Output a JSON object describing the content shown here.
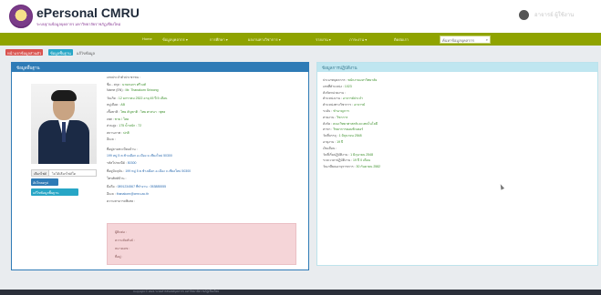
{
  "app": {
    "title": "ePersonal CMRU",
    "subtitle": "ระบบฐานข้อมูลบุคลากร มหาวิทยาลัยราชภัฏเชียงใหม่",
    "user_name": "อาจารย์ ผู้ใช้งาน"
  },
  "nav": {
    "items": [
      "Home",
      "ข้อมูลบุคลากร ▾",
      "การศึกษา ▾",
      "ผลงานทางวิชาการ ▾",
      "รายงาน ▾",
      "ภาระงาน ▾",
      "ติดต่อเรา"
    ],
    "search_placeholder": "ค้นหาข้อมูลบุคลากร"
  },
  "breadcrumbs": [
    "หน้าแรกข้อมูลส่วนตัว",
    "ข้อมูลพื้นฐาน",
    "แก้ไขข้อมูล"
  ],
  "colors": {
    "nav": "#8fa300",
    "panel_blue": "#2e7bb6",
    "panel_cyan": "#bfe6f0",
    "danger_box": "#f5d5d8"
  },
  "left_panel": {
    "title": "ข้อมูลพื้นฐาน",
    "file_button": "เลือกไฟล์",
    "file_text": "ไม่ได้เลือกไฟล์ใด",
    "upload_button": "อัปโหลดรูป",
    "edit_button": "แก้ไขข้อมูลพื้นฐาน",
    "lines": [
      [
        "เลขประจำตัวประชาชน :",
        ""
      ],
      [
        "ชื่อ - สกุล :",
        "นายธนกร  ศรีวงศ์"
      ],
      [
        "Name (EN) :",
        "Mr. Thanakorn  Sriwong"
      ],
      [
        "วันเกิด :",
        "12 มกราคม 2522  อายุ 45 ปี 5 เดือน"
      ],
      [
        "หมู่เลือด :",
        "AB"
      ],
      [
        "เชื้อชาติ :",
        "ไทย   สัญชาติ : ไทย   ศาสนา : พุทธ"
      ],
      [
        "เพศ :",
        "ชาย / โสด"
      ],
      [
        "ส่วนสูง :",
        "175  น้ำหนัก : 72"
      ],
      [
        "สถานภาพ :",
        "ปกติ"
      ],
      [
        "อีเมล :",
        ""
      ]
    ],
    "address_header": "ที่อยู่ตามทะเบียนบ้าน :",
    "address_lines": [
      [
        "",
        "199 หมู่ 5 ต.ช้างเผือก อ.เมือง จ.เชียงใหม่ 50300"
      ],
      [
        "รหัสไปรษณีย์ :",
        "50300"
      ],
      [
        "ที่อยู่ปัจจุบัน :",
        "199 หมู่ 5 ต.ช้างเผือก อ.เมือง จ.เชียงใหม่ 50300"
      ],
      [
        "โทรศัพท์บ้าน :",
        ""
      ],
      [
        "มือถือ :",
        "0891234567  ที่ทำงาน : 053885555"
      ],
      [
        "อีเมล :",
        "thanakorn@cmru.ac.th"
      ],
      [
        "ความสามารถพิเศษ :",
        ""
      ]
    ],
    "alert_lines": [
      "ผู้ติดต่อ :",
      "ความสัมพันธ์ :",
      "หมายเลข :",
      "ที่อยู่ :"
    ]
  },
  "right_panel": {
    "title": "ข้อมูลการปฏิบัติงาน",
    "lines": [
      [
        "ประเภทบุคลากร :",
        "พนักงานมหาวิทยาลัย"
      ],
      [
        "เลขที่ตำแหน่ง :",
        "1023"
      ],
      [
        "สังกัดหน่วยงาน :",
        ""
      ],
      [
        "ตำแหน่งงาน :",
        "อาจารย์ประจำ"
      ],
      [
        "ตำแหน่งทางวิชาการ :",
        "อาจารย์"
      ],
      [
        "ระดับ :",
        "ชำนาญการ"
      ],
      [
        "สายงาน :",
        "วิชาการ"
      ],
      [
        "สังกัด :",
        "คณะวิทยาศาสตร์และเทคโนโลยี"
      ],
      [
        "สาขา :",
        "วิทยาการคอมพิวเตอร์"
      ],
      [
        "วันที่บรรจุ :",
        "1 มิถุนายน 2548"
      ],
      [
        "อายุงาน :",
        "19 ปี"
      ],
      [
        "เงินเดือน :",
        ""
      ],
      [
        "วันที่เริ่มปฏิบัติงาน :",
        "1 มิถุนายน 2548"
      ],
      [
        "ระยะเวลาปฏิบัติงาน :",
        "19 ปี 0 เดือน"
      ],
      [
        "วันเกษียณอายุราชการ :",
        "30 กันยายน 2582"
      ]
    ]
  },
  "footer": {
    "text": "Copyright © 2024 ระบบสารสนเทศบุคลากร มหาวิทยาลัยราชภัฏเชียงใหม่"
  }
}
